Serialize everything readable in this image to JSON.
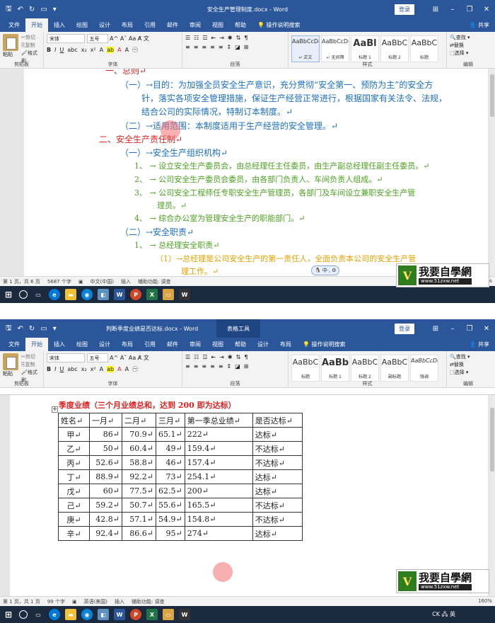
{
  "w1": {
    "title": "安全生产管理制度.docx - Word",
    "login": "登录",
    "share": "共享",
    "tabs": [
      "文件",
      "开始",
      "插入",
      "绘图",
      "设计",
      "布局",
      "引用",
      "邮件",
      "审阅",
      "视图",
      "帮助"
    ],
    "search_tell": "操作说明搜索",
    "font_name": "宋体",
    "font_size": "五号",
    "clipboard": {
      "paste": "粘贴",
      "cut": "剪切",
      "copy": "复制",
      "painter": "格式刷",
      "label": "剪贴板"
    },
    "group_labels": {
      "font": "字体",
      "paragraph": "段落",
      "styles": "样式",
      "editing": "编辑"
    },
    "styles": [
      {
        "preview": "AaBbCcDd",
        "name": "↵ 正文"
      },
      {
        "preview": "AaBbCcDd",
        "name": "↵ 无间隔"
      },
      {
        "preview": "AaBl",
        "name": "标题 1"
      },
      {
        "preview": "AaBbC",
        "name": "标题 2"
      },
      {
        "preview": "AaBbC",
        "name": "标题"
      }
    ],
    "editing": [
      "查找 ▾",
      "替换",
      "选择 ▾"
    ],
    "doc_lines": [
      {
        "text": "一、总则↵",
        "color": "red"
      },
      {
        "text": "（一）→目的：为加强全员安全生产意识，充分贯彻“安全第一、预防为主”的安全方",
        "color": "blue"
      },
      {
        "text": "针，落实各项安全管理措施，保证生产经营正常进行，根据国家有关法令、法规，",
        "color": "blue"
      },
      {
        "text": "结合公司的实际情况，特制订本制度。↵",
        "color": "blue"
      },
      {
        "text": "（二）→适用范围：本制度适用于生产经营的安全管理。↵",
        "color": "blue"
      },
      {
        "text": "二、安全生产责任制↵",
        "color": "red"
      },
      {
        "text": "（一）→安全生产组织机构↵",
        "color": "blue"
      },
      {
        "text": "1、 → 设立安全生产委员会，由总经理任主任委员，由生产副总经理任副主任委员。↵",
        "color": "green"
      },
      {
        "text": "2、 → 公司安全生产委员会委员，由各部门负责人、车间负责人组成。↵",
        "color": "green"
      },
      {
        "text": "3、 → 公司安全工程师任专职安全生产管理员，各部门及车间设立兼职安全生产管",
        "color": "green"
      },
      {
        "text": "理员。↵",
        "color": "green"
      },
      {
        "text": "4、 → 综合办公室为管理安全生产的职能部门。↵",
        "color": "green"
      },
      {
        "text": "（二）→安全职责↵",
        "color": "blue"
      },
      {
        "text": "1、 → 总经理安全职责↵",
        "color": "green"
      },
      {
        "text": "（1）→总经理是公司安全生产的第一责任人，全面负责本公司的安全生产管",
        "color": "orange"
      },
      {
        "text": "理工作。↵",
        "color": "orange"
      }
    ],
    "status": [
      "第 1 页，共 6 页",
      "5687 个字",
      "中文(中国)",
      "插入",
      "辅助功能: 调查"
    ],
    "zoom": "160%"
  },
  "w2": {
    "title": "判断季度业绩是否达标.docx - Word",
    "context_tab": "表格工具",
    "login": "登录",
    "share": "共享",
    "tabs": [
      "文件",
      "开始",
      "插入",
      "绘图",
      "设计",
      "布局",
      "引用",
      "邮件",
      "审阅",
      "视图",
      "帮助",
      "设计",
      "布局"
    ],
    "search_tell": "操作说明搜索",
    "font_name": "宋体",
    "font_size": "五号",
    "clipboard": {
      "paste": "粘贴",
      "cut": "剪切",
      "copy": "复制",
      "painter": "格式刷",
      "label": "剪贴板"
    },
    "group_labels": {
      "font": "字体",
      "paragraph": "段落",
      "styles": "样式",
      "editing": "编辑"
    },
    "styles": [
      {
        "preview": "AaBbC",
        "name": "标题"
      },
      {
        "preview": "AaBb",
        "name": "标题 1"
      },
      {
        "preview": "AaBbC",
        "name": "标题 2"
      },
      {
        "preview": "AaBbC",
        "name": "副标题"
      },
      {
        "preview": "AaBbCcDc",
        "name": "强调"
      }
    ],
    "editing": [
      "查找 ▾",
      "替换",
      "选择 ▾"
    ],
    "heading": "季度业绩（三个月业绩总和，达到 200 即为达标）",
    "table": {
      "headers": [
        "姓名↵",
        "一月↵",
        "二月↵",
        "三月↵",
        "第一季总业绩↵",
        "是否达标↵"
      ],
      "rows": [
        [
          "甲↵",
          "86↵",
          "70.9↵",
          "65.1↵",
          "222↵",
          "达标↵"
        ],
        [
          "乙↵",
          "50↵",
          "60.4↵",
          "49↵",
          "159.4↵",
          "不达标↵"
        ],
        [
          "丙↵",
          "52.6↵",
          "58.8↵",
          "46↵",
          "157.4↵",
          "不达标↵"
        ],
        [
          "丁↵",
          "88.9↵",
          "92.2↵",
          "73↵",
          "254.1↵",
          "达标↵"
        ],
        [
          "戊↵",
          "60↵",
          "77.5↵",
          "62.5↵",
          "200↵",
          "达标↵"
        ],
        [
          "己↵",
          "59.2↵",
          "50.7↵",
          "55.6↵",
          "165.5↵",
          "不达标↵"
        ],
        [
          "庚↵",
          "42.8↵",
          "57.1↵",
          "54.9↵",
          "154.8↵",
          "不达标↵"
        ],
        [
          "辛↵",
          "92.4↵",
          "86.6↵",
          "95↵",
          "274↵",
          "达标↵"
        ]
      ]
    },
    "status": [
      "第 1 页，共 1 页",
      "99 个字",
      "英语(美国)",
      "插入",
      "辅助功能: 调查"
    ],
    "zoom": "160%"
  },
  "logo": {
    "main": "我要自學網",
    "url": "www.51zxw.net"
  },
  "tray": {
    "ime": "CK",
    "lang": "英"
  },
  "colors": {
    "word_blue": "#2b579a",
    "red": "#e02020",
    "blue": "#1a6fc4",
    "green": "#4aa31f",
    "orange": "#e5a100"
  }
}
